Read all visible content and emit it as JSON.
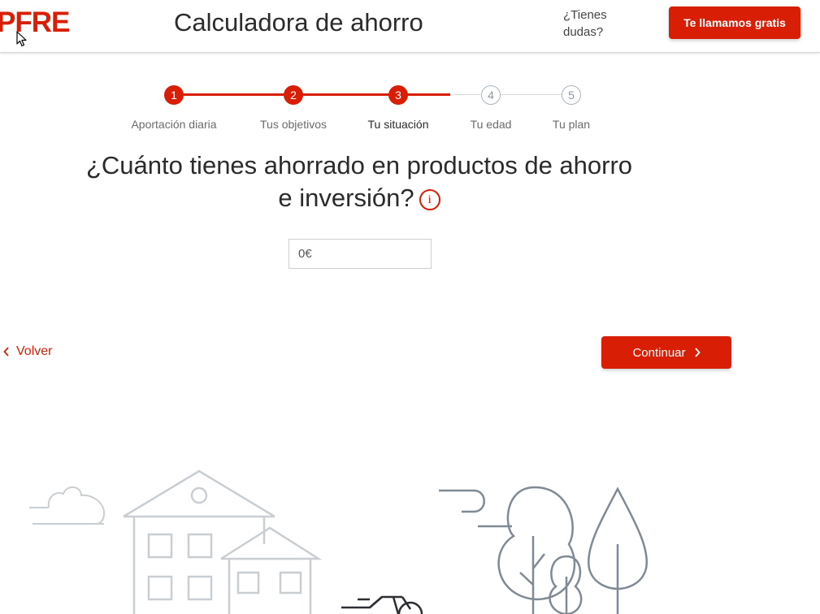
{
  "header": {
    "logo_text": "PFRE",
    "title": "Calculadora de ahorro",
    "doubts_text": "¿Tienes dudas?",
    "call_button": "Te llamamos gratis"
  },
  "steps": [
    {
      "number": "1",
      "label": "Aportación diaria",
      "status": "done"
    },
    {
      "number": "2",
      "label": "Tus objetivos",
      "status": "done"
    },
    {
      "number": "3",
      "label": "Tu situación",
      "status": "current"
    },
    {
      "number": "4",
      "label": "Tu edad",
      "status": "pending"
    },
    {
      "number": "5",
      "label": "Tu plan",
      "status": "pending"
    }
  ],
  "question": "¿Cuánto tienes ahorrado en productos de ahorro e inversión?",
  "amount_value": "0€",
  "back_label": "Volver",
  "continue_label": "Continuar",
  "colors": {
    "accent": "#d81e05",
    "pending_step": "#a9b4be",
    "illustration": "#c9ced3"
  },
  "icons": [
    "info-icon",
    "chevron-left-icon",
    "chevron-right-icon",
    "mouse-cursor-icon"
  ]
}
